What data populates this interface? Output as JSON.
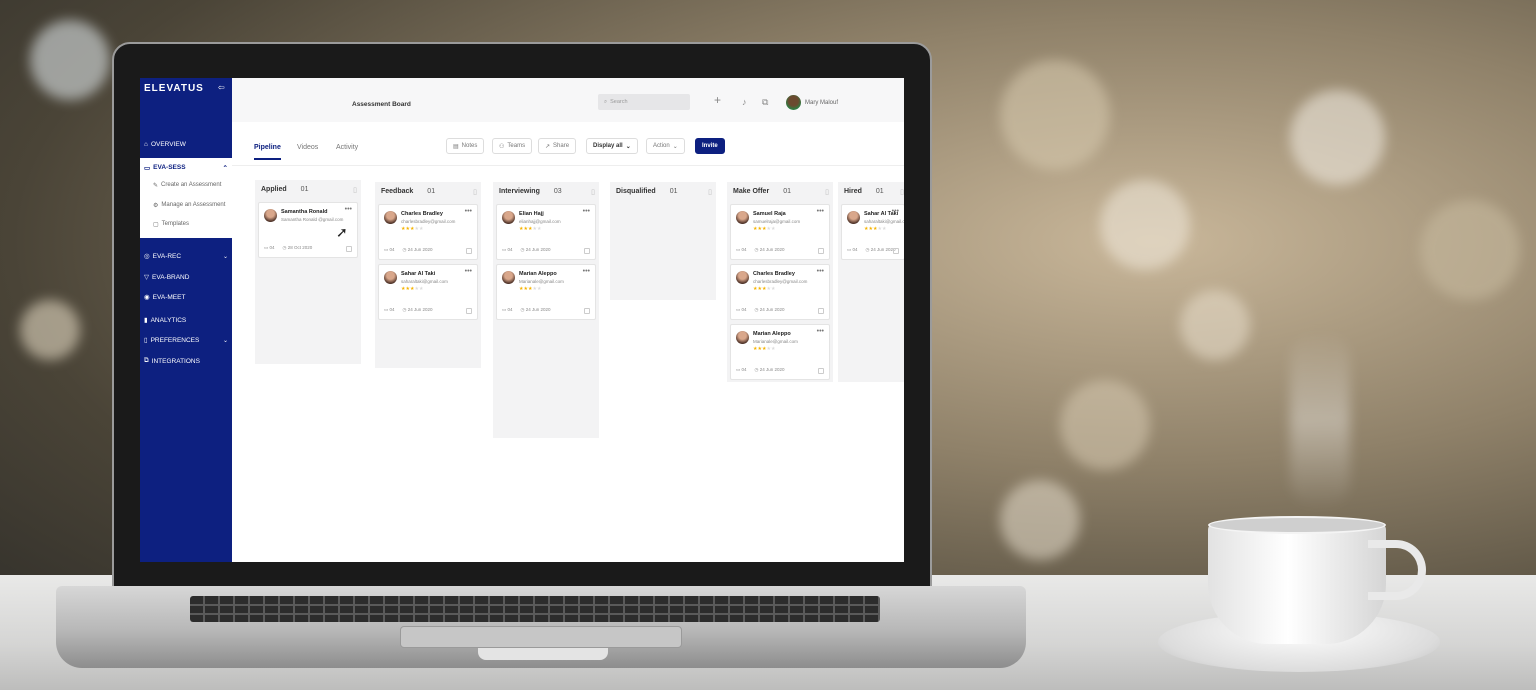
{
  "app": {
    "logo": "ELEVATUS",
    "page_title": "Assessment Board",
    "user_name": "Mary Malouf",
    "accent": "#0d2080"
  },
  "sidebar": {
    "overview": "OVERVIEW",
    "eva_sess": "EVA-SESS",
    "sub_items": [
      "Create an Assessment",
      "Manage an Assessment",
      "Templates"
    ],
    "eva_rec": "EVA-REC",
    "eva_brand": "EVA-BRAND",
    "eva_meet": "EVA-MEET",
    "analytics": "ANALYTICS",
    "preferences": "PREFERENCES",
    "integrations": "INTEGRATIONS"
  },
  "search": {
    "placeholder": "Search"
  },
  "tabs": [
    "Pipeline",
    "Videos",
    "Activity"
  ],
  "toolbar": {
    "notes": "Notes",
    "teams": "Teams",
    "share": "Share",
    "display_all": "Display all",
    "action": "Action",
    "invite": "Invite"
  },
  "columns": [
    {
      "title": "Applied",
      "count": "01",
      "cards": [
        {
          "name": "Samantha Ronald",
          "email": "Samantha Ronald @gmail.com",
          "rating": 0,
          "comments": "04",
          "date": "28 Oct 2020"
        }
      ]
    },
    {
      "title": "Feedback",
      "count": "01",
      "cards": [
        {
          "name": "Charles Bradley",
          "email": "charlesbradley@gmail.com",
          "rating": 3,
          "comments": "04",
          "date": "24 Jun 2020"
        },
        {
          "name": "Sahar Al Taki",
          "email": "saharaltaki@gmail.com",
          "rating": 3,
          "comments": "04",
          "date": "24 Jun 2020"
        }
      ]
    },
    {
      "title": "Interviewing",
      "count": "03",
      "cards": [
        {
          "name": "Elian Hajj",
          "email": "elianhajj@gmail.com",
          "rating": 3,
          "comments": "04",
          "date": "24 Jun 2020"
        },
        {
          "name": "Marian Aleppo",
          "email": "Marianale@gmail.com",
          "rating": 3,
          "comments": "04",
          "date": "24 Jun 2020"
        }
      ]
    },
    {
      "title": "Disqualified",
      "count": "01",
      "cards": []
    },
    {
      "title": "Make Offer",
      "count": "01",
      "cards": [
        {
          "name": "Samuel Raja",
          "email": "samuelraja@gmail.com",
          "rating": 3,
          "comments": "04",
          "date": "24 Jun 2020"
        },
        {
          "name": "Charles Bradley",
          "email": "charlesbradley@gmail.com",
          "rating": 3,
          "comments": "04",
          "date": "24 Jun 2020"
        },
        {
          "name": "Marian Aleppo",
          "email": "Marianale@gmail.com",
          "rating": 3,
          "comments": "04",
          "date": "24 Jun 2020"
        }
      ]
    },
    {
      "title": "Hired",
      "count": "01",
      "cards": [
        {
          "name": "Sahar Al Taki",
          "email": "saharaltaki@gmail.com",
          "rating": 3,
          "comments": "04",
          "date": "24 Jun 2020"
        }
      ]
    }
  ]
}
